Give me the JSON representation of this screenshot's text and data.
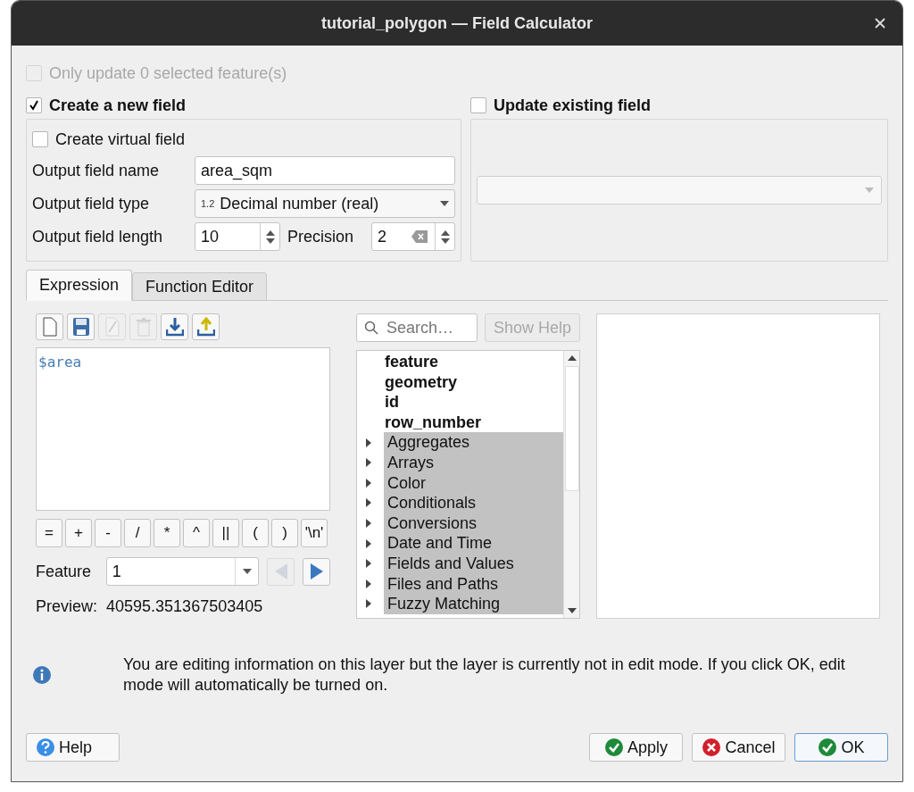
{
  "window": {
    "title": "tutorial_polygon — Field Calculator"
  },
  "only_selected": {
    "label": "Only update 0 selected feature(s)",
    "checked": false,
    "disabled": true
  },
  "create_field": {
    "label": "Create a new field",
    "checked": true,
    "virtual": {
      "label": "Create virtual field",
      "checked": false
    },
    "name": {
      "label": "Output field name",
      "value": "area_sqm"
    },
    "type": {
      "label": "Output field type",
      "badge": "1.2",
      "value": "Decimal number (real)"
    },
    "length": {
      "label": "Output field length",
      "value": "10"
    },
    "precision": {
      "label": "Precision",
      "value": "2"
    }
  },
  "update_field": {
    "label": "Update existing field",
    "checked": false
  },
  "tabs": [
    {
      "label": "Expression",
      "selected": true
    },
    {
      "label": "Function Editor",
      "selected": false
    }
  ],
  "toolbar": [
    {
      "disabled": false
    },
    {
      "disabled": false
    },
    {
      "disabled": true
    },
    {
      "disabled": true
    },
    {
      "disabled": false
    },
    {
      "disabled": false
    }
  ],
  "expression": "$area",
  "operators": [
    "=",
    "+",
    "-",
    "/",
    "*",
    "^",
    "||",
    "(",
    ")",
    "'\\n'"
  ],
  "feature": {
    "label": "Feature",
    "value": "1",
    "prev_disabled": true,
    "next_disabled": false
  },
  "preview": {
    "label": "Preview:",
    "value": "40595.351367503405"
  },
  "search": {
    "placeholder": "Search…"
  },
  "show_help": {
    "label": "Show Help",
    "disabled": true
  },
  "functions": [
    {
      "kind": "variable",
      "label": "feature"
    },
    {
      "kind": "variable",
      "label": "geometry"
    },
    {
      "kind": "variable",
      "label": "id"
    },
    {
      "kind": "variable",
      "label": "row_number"
    },
    {
      "kind": "group",
      "label": "Aggregates"
    },
    {
      "kind": "group",
      "label": "Arrays"
    },
    {
      "kind": "group",
      "label": "Color"
    },
    {
      "kind": "group",
      "label": "Conditionals"
    },
    {
      "kind": "group",
      "label": "Conversions"
    },
    {
      "kind": "group",
      "label": "Date and Time"
    },
    {
      "kind": "group",
      "label": "Fields and Values"
    },
    {
      "kind": "group",
      "label": "Files and Paths"
    },
    {
      "kind": "group",
      "label": "Fuzzy Matching"
    }
  ],
  "message": "You are editing information on this layer but the layer is currently not in edit mode. If you click OK, edit mode will automatically be turned on.",
  "buttons": [
    {
      "kind": "help",
      "label": "Help"
    },
    {
      "kind": "apply",
      "label": "Apply"
    },
    {
      "kind": "cancel",
      "label": "Cancel"
    },
    {
      "kind": "ok",
      "label": "OK"
    }
  ]
}
